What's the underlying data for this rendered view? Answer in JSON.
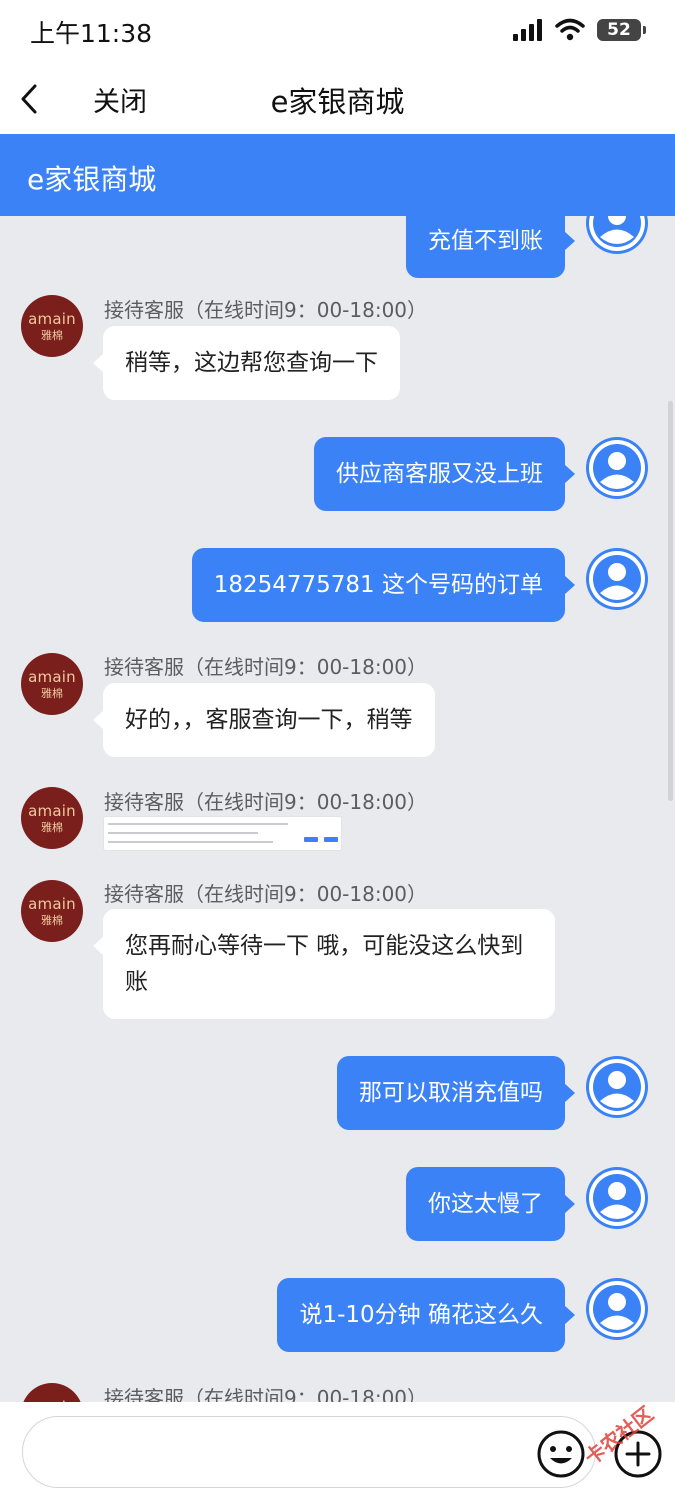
{
  "status": {
    "time": "上午11:38",
    "battery": "52"
  },
  "nav": {
    "close_label": "关闭",
    "title": "e家银商城"
  },
  "header": {
    "title": "e家银商城"
  },
  "agent": {
    "avatar_brand": "amain",
    "avatar_cn": "雅棉",
    "name": "接待客服（在线时间9：00-18:00）"
  },
  "messages": [
    {
      "from": "user",
      "text": "充值不到账"
    },
    {
      "from": "agent",
      "text": "稍等，这边帮您查询一下"
    },
    {
      "from": "user",
      "text": "供应商客服又没上班"
    },
    {
      "from": "user",
      "text": "18254775781 这个号码的订单"
    },
    {
      "from": "agent",
      "text": "好的，，客服查询一下，稍等"
    },
    {
      "from": "agent",
      "type": "image"
    },
    {
      "from": "agent",
      "text": "您再耐心等待一下 哦，可能没这么快到账"
    },
    {
      "from": "user",
      "text": "那可以取消充值吗"
    },
    {
      "from": "user",
      "text": "你这太慢了"
    },
    {
      "from": "user",
      "text": "说1-10分钟 确花这么久"
    },
    {
      "from": "agent",
      "text": ""
    }
  ],
  "input": {
    "placeholder": ""
  },
  "watermark": "卡农社区",
  "colors": {
    "accent": "#3b82f6",
    "agent_avatar": "#7a1f1c",
    "chat_bg": "#e9eaee"
  }
}
